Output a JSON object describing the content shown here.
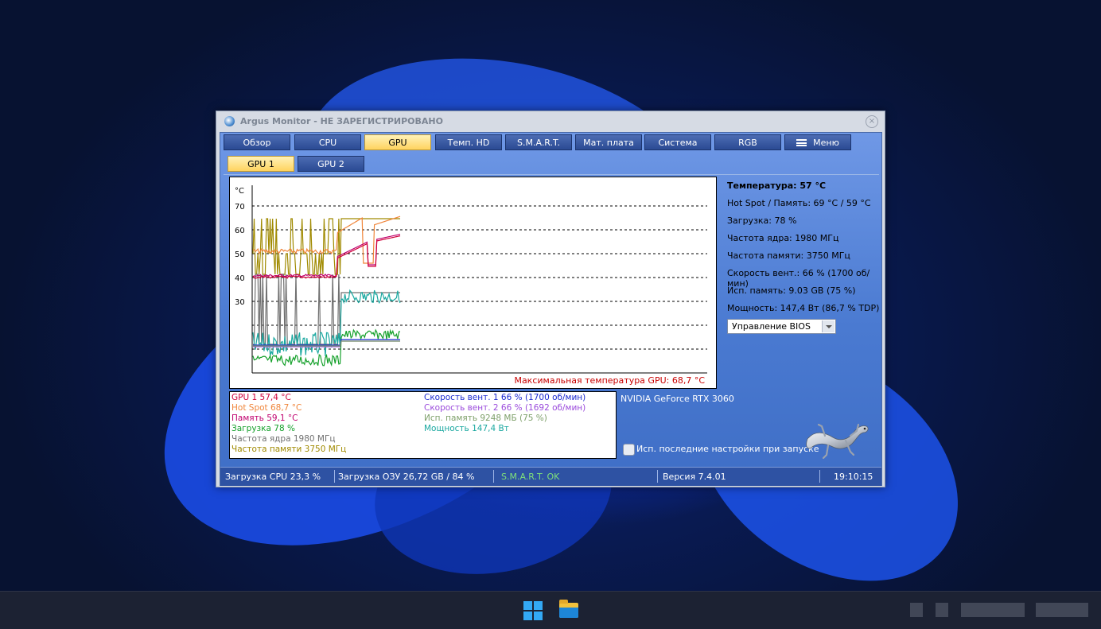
{
  "window": {
    "title": "Argus Monitor - НЕ ЗАРЕГИСТРИРОВАНО",
    "close_symbol": "×"
  },
  "tabs": [
    "Обзор",
    "CPU",
    "GPU",
    "Темп. HD",
    "S.M.A.R.T.",
    "Мат. плата",
    "Система",
    "RGB"
  ],
  "active_tab": "GPU",
  "menu_label": "Меню",
  "subtabs": [
    "GPU 1",
    "GPU 2"
  ],
  "active_subtab": "GPU 1",
  "chart": {
    "unit": "°C",
    "ticks": [
      "70",
      "60",
      "50",
      "40",
      "30"
    ],
    "max_label": "Максимальная температура GPU: 68,7 °C"
  },
  "info": {
    "temperature": "Температура: 57 °C",
    "hotspot_memory": "Hot Spot / Память: 69 °C / 59 °C",
    "load": "Загрузка: 78 %",
    "core_clock": "Частота ядра: 1980 МГц",
    "memory_clock": "Частота памяти: 3750 МГц",
    "fan_speed": "Скорость вент.: 66 % (1700 об/мин)",
    "used_memory": "Исп. память: 9.03 GB (75 %)",
    "power": "Мощность: 147,4 Вт (86,7 % TDP)"
  },
  "bios_select": "Управление BIOS",
  "legend": {
    "left": [
      {
        "text": "GPU 1 57,4 °C",
        "color": "#d0003a"
      },
      {
        "text": "Hot Spot 68,7 °C",
        "color": "#f0853a"
      },
      {
        "text": "Память 59,1 °C",
        "color": "#c0006e"
      },
      {
        "text": "Загрузка 78 %",
        "color": "#14a02a"
      },
      {
        "text": "Частота ядра 1980 МГц",
        "color": "#707070"
      },
      {
        "text": "Частота памяти 3750 МГц",
        "color": "#a08a00"
      }
    ],
    "right": [
      {
        "text": "Скорость вент. 1 66 % (1700 об/мин)",
        "color": "#1a2ad0"
      },
      {
        "text": "Скорость вент. 2 66 % (1692 об/мин)",
        "color": "#9a4adc"
      },
      {
        "text": "Исп. память 9248 МБ (75 %)",
        "color": "#7ea06a"
      },
      {
        "text": "Мощность 147,4 Вт",
        "color": "#1aa8a0"
      }
    ]
  },
  "gpu_name": "NVIDIA GeForce RTX 3060",
  "checkbox_label": "Исп. последние настройки при запуске",
  "status": {
    "cpu_load": "Загрузка CPU 23,3 %",
    "ram_load": "Загрузка ОЗУ 26,72 GB / 84 %",
    "smart": "S.M.A.R.T. OK",
    "version": "Версия 7.4.01",
    "time": "19:10:15"
  }
}
